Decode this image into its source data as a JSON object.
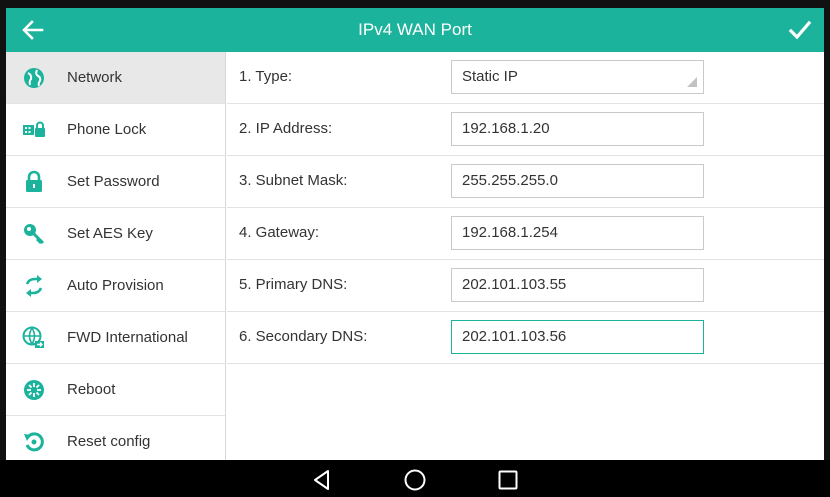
{
  "header": {
    "title": "IPv4 WAN Port",
    "back_icon": "arrow-left-icon",
    "confirm_icon": "checkmark-icon",
    "accent_color": "#1cb39c"
  },
  "sidebar": {
    "items": [
      {
        "label": "Network",
        "icon": "globe-icon",
        "active": true
      },
      {
        "label": "Phone Lock",
        "icon": "keypad-lock-icon",
        "active": false
      },
      {
        "label": "Set Password",
        "icon": "padlock-icon",
        "active": false
      },
      {
        "label": "Set AES Key",
        "icon": "key-icon",
        "active": false
      },
      {
        "label": "Auto Provision",
        "icon": "sync-arrows-icon",
        "active": false
      },
      {
        "label": "FWD International",
        "icon": "globe-forward-icon",
        "active": false
      },
      {
        "label": "Reboot",
        "icon": "reboot-icon",
        "active": false
      },
      {
        "label": "Reset config",
        "icon": "reset-icon",
        "active": false
      }
    ]
  },
  "form": {
    "rows": [
      {
        "label": "1. Type:",
        "value": "Static IP",
        "kind": "select"
      },
      {
        "label": "2. IP Address:",
        "value": "192.168.1.20",
        "kind": "text"
      },
      {
        "label": "3. Subnet Mask:",
        "value": "255.255.255.0",
        "kind": "text"
      },
      {
        "label": "4. Gateway:",
        "value": "192.168.1.254",
        "kind": "text"
      },
      {
        "label": "5. Primary DNS:",
        "value": "202.101.103.55",
        "kind": "text"
      },
      {
        "label": "6. Secondary DNS:",
        "value": "202.101.103.56",
        "kind": "text",
        "focused": true
      }
    ]
  },
  "navbar": {
    "buttons": [
      "back-triangle-icon",
      "home-circle-icon",
      "recents-square-icon"
    ]
  }
}
